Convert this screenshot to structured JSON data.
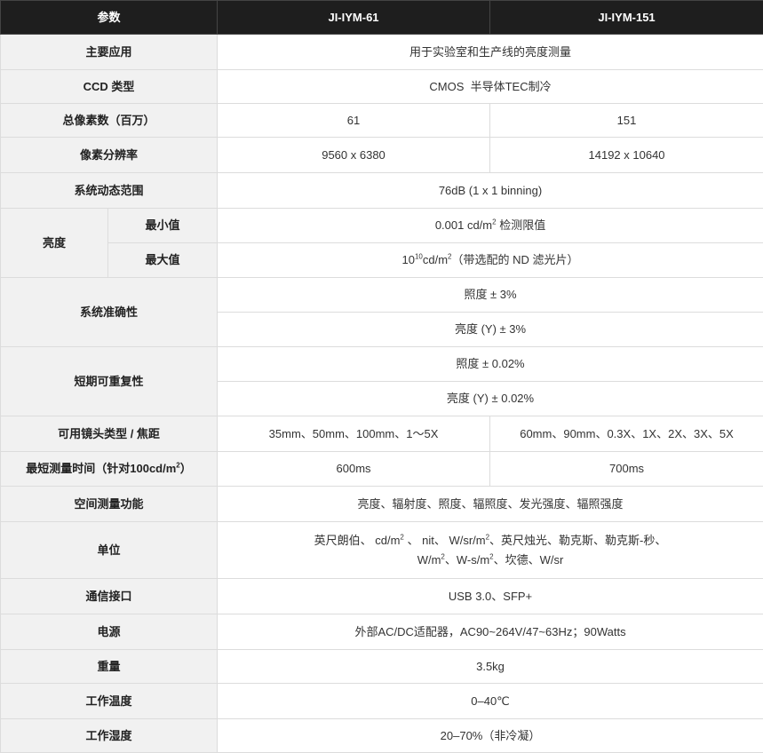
{
  "header": {
    "param": "参数",
    "model_a": "JI-IYM-61",
    "model_b": "JI-IYM-151"
  },
  "rows": {
    "application": {
      "label": "主要应用",
      "value": "用于实验室和生产线的亮度测量"
    },
    "ccd_type": {
      "label": "CCD 类型",
      "value": "CMOS  半导体TEC制冷"
    },
    "pixels": {
      "label": "总像素数（百万）",
      "a": "61",
      "b": "151"
    },
    "resolution": {
      "label": "像素分辨率",
      "a": "9560 x 6380",
      "b": "14192 x 10640"
    },
    "dynamic_range": {
      "label": "系统动态范围",
      "value": "76dB (1 x 1 binning)"
    },
    "luminance": {
      "label": "亮度",
      "min_label": "最小值",
      "min_prefix": "0.001 cd/m",
      "min_sup": "2",
      "min_suffix": " 检测限值",
      "max_label": "最大值",
      "max_prefix": "10",
      "max_sup": "10",
      "max_unit": "cd/m",
      "max_unit_sup": "2",
      "max_suffix": "（带选配的 ND 滤光片）"
    },
    "accuracy": {
      "label": "系统准确性",
      "v1": "照度 ± 3%",
      "v2": "亮度 (Y) ± 3%"
    },
    "repeatability": {
      "label": "短期可重复性",
      "v1": "照度 ± 0.02%",
      "v2": "亮度 (Y) ± 0.02%"
    },
    "lens": {
      "label": "可用镜头类型 / 焦距",
      "a": "35mm、50mm、100mm、1～5X",
      "b": "60mm、90mm、0.3X、1X、2X、3X、5X"
    },
    "min_time": {
      "label_prefix": "最短测量时间（针对100cd/m",
      "label_sup": "2",
      "label_suffix": "）",
      "a": "600ms",
      "b": "700ms"
    },
    "spatial": {
      "label": "空间测量功能",
      "value": "亮度、辐射度、照度、辐照度、发光强度、辐照强度"
    },
    "units": {
      "label": "单位",
      "l1_a": "英尺朗伯、 cd/m",
      "l1_a_sup": "2",
      "l1_b": " 、 nit、 W/sr/m",
      "l1_b_sup": "2",
      "l1_c": "、英尺烛光、勒克斯、勒克斯-秒、",
      "l2_a": "W/m",
      "l2_a_sup": "2",
      "l2_b": "、W-s/m",
      "l2_b_sup": "2",
      "l2_c": "、坎德、W/sr"
    },
    "interface": {
      "label": "通信接口",
      "value": "USB 3.0、SFP+"
    },
    "power": {
      "label": "电源",
      "value": "外部AC/DC适配器，AC90~264V/47~63Hz；90Watts"
    },
    "weight": {
      "label": "重量",
      "value": "3.5kg"
    },
    "op_temp": {
      "label": "工作温度",
      "value": "0–40℃"
    },
    "op_humidity": {
      "label": "工作湿度",
      "value": "20–70%（非冷凝）"
    }
  }
}
